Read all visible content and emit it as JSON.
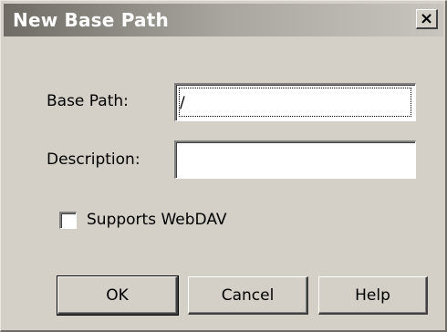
{
  "dialog": {
    "title": "New Base Path",
    "close_icon": "close-icon",
    "close_glyph": "×"
  },
  "fields": {
    "base_path": {
      "label": "Base Path:",
      "value": "/"
    },
    "description": {
      "label": "Description:",
      "value": ""
    }
  },
  "options": {
    "supports_webdav": {
      "label": "Supports WebDAV",
      "checked": false
    }
  },
  "buttons": {
    "ok": "OK",
    "cancel": "Cancel",
    "help": "Help"
  }
}
